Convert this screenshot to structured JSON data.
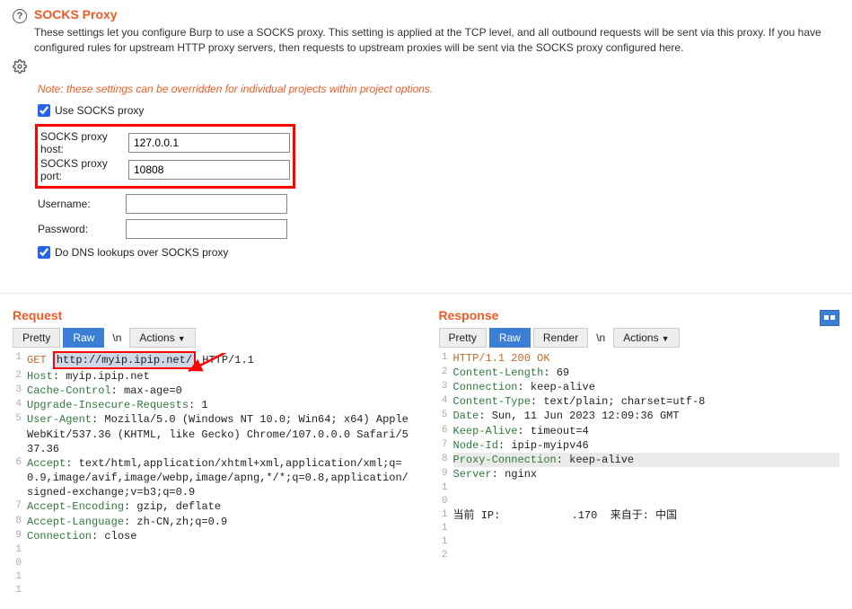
{
  "socks": {
    "title": "SOCKS Proxy",
    "desc": "These settings let you configure Burp to use a SOCKS proxy. This setting is applied at the TCP level, and all outbound requests will be sent via this proxy. If you have configured rules for upstream HTTP proxy servers, then requests to upstream proxies will be sent via the SOCKS proxy configured here.",
    "note": "Note: these settings can be overridden for individual projects within project options.",
    "use_label": "Use SOCKS proxy",
    "use_checked": true,
    "host_label": "SOCKS proxy host:",
    "host_value": "127.0.0.1",
    "port_label": "SOCKS proxy port:",
    "port_value": "10808",
    "user_label": "Username:",
    "user_value": "",
    "pass_label": "Password:",
    "pass_value": "",
    "dns_label": "Do DNS lookups over SOCKS proxy",
    "dns_checked": true
  },
  "tabs": {
    "pretty": "Pretty",
    "raw": "Raw",
    "render": "Render",
    "newline": "\\n",
    "actions": "Actions"
  },
  "request": {
    "title": "Request",
    "method": "GET",
    "url": "http://myip.ipip.net/",
    "httpver": "HTTP/1.1",
    "lines": [
      {
        "n": "2",
        "h": "Host",
        "v": " myip.ipip.net"
      },
      {
        "n": "3",
        "h": "Cache-Control",
        "v": " max-age=0"
      },
      {
        "n": "4",
        "h": "Upgrade-Insecure-Requests",
        "v": " 1"
      },
      {
        "n": "5",
        "h": "User-Agent",
        "v": " Mozilla/5.0 (Windows NT 10.0; Win64; x64) AppleWebKit/537.36 (KHTML, like Gecko) Chrome/107.0.0.0 Safari/537.36"
      },
      {
        "n": "6",
        "h": "Accept",
        "v": " text/html,application/xhtml+xml,application/xml;q=0.9,image/avif,image/webp,image/apng,*/*;q=0.8,application/signed-exchange;v=b3;q=0.9"
      },
      {
        "n": "7",
        "h": "Accept-Encoding",
        "v": " gzip, deflate"
      },
      {
        "n": "8",
        "h": "Accept-Language",
        "v": " zh-CN,zh;q=0.9"
      },
      {
        "n": "9",
        "h": "Connection",
        "v": " close"
      }
    ],
    "empty1": "10",
    "empty2": "11"
  },
  "response": {
    "title": "Response",
    "status_line": "HTTP/1.1 200 OK",
    "lines": [
      {
        "n": "2",
        "h": "Content-Length",
        "v": " 69"
      },
      {
        "n": "3",
        "h": "Connection",
        "v": " keep-alive"
      },
      {
        "n": "4",
        "h": "Content-Type",
        "v": " text/plain; charset=utf-8"
      },
      {
        "n": "5",
        "h": "Date",
        "v": " Sun, 11 Jun 2023 12:09:36 GMT"
      },
      {
        "n": "6",
        "h": "Keep-Alive",
        "v": " timeout=4"
      },
      {
        "n": "7",
        "h": "Node-Id",
        "v": " ipip-myipv46"
      },
      {
        "n": "8",
        "h": "Proxy-Connection",
        "v": " keep-alive",
        "hl": true
      },
      {
        "n": "9",
        "h": "Server",
        "v": " nginx"
      }
    ],
    "body_n": "11",
    "body": "当前 IP:           .170  来自于: 中国",
    "empty1": "10",
    "empty2": "12"
  }
}
